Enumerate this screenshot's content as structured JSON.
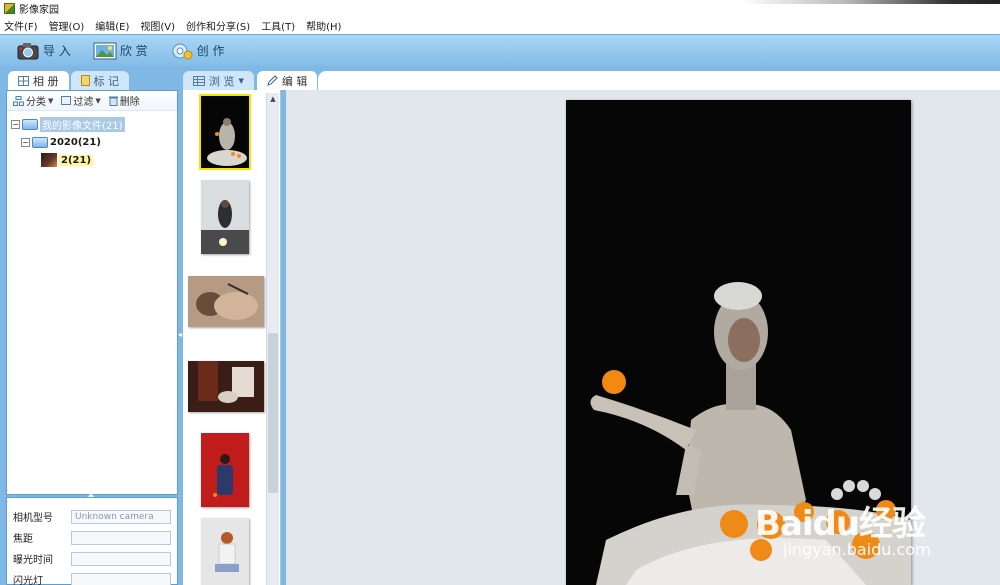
{
  "window": {
    "title": "影像家园"
  },
  "menubar": {
    "items": [
      "文件(F)",
      "管理(O)",
      "编辑(E)",
      "视图(V)",
      "创作和分享(S)",
      "工具(T)",
      "帮助(H)"
    ]
  },
  "toolbar": {
    "import_label": "导 入",
    "view_label": "欣 赏",
    "create_label": "创 作"
  },
  "left_tabs": {
    "album": "相 册",
    "tag": "标 记"
  },
  "left_actions": {
    "classify": "分类",
    "filter": "过滤",
    "delete": "删除"
  },
  "tree": {
    "root": "我的影像文件(21)",
    "year": "2020(21)",
    "album": "2(21)"
  },
  "properties": {
    "camera_model_label": "相机型号",
    "camera_model_value": "Unknown camera",
    "focal_length_label": "焦距",
    "exposure_time_label": "曝光时间",
    "flash_label": "闪光灯"
  },
  "view_tabs": {
    "browse": "浏 览",
    "edit": "编 辑"
  },
  "watermark": {
    "brand": "Baidu经验",
    "url": "jingyan.baidu.com"
  },
  "colors": {
    "panel_blue": "#7fb8e4",
    "selection_yellow": "#f4e400"
  }
}
